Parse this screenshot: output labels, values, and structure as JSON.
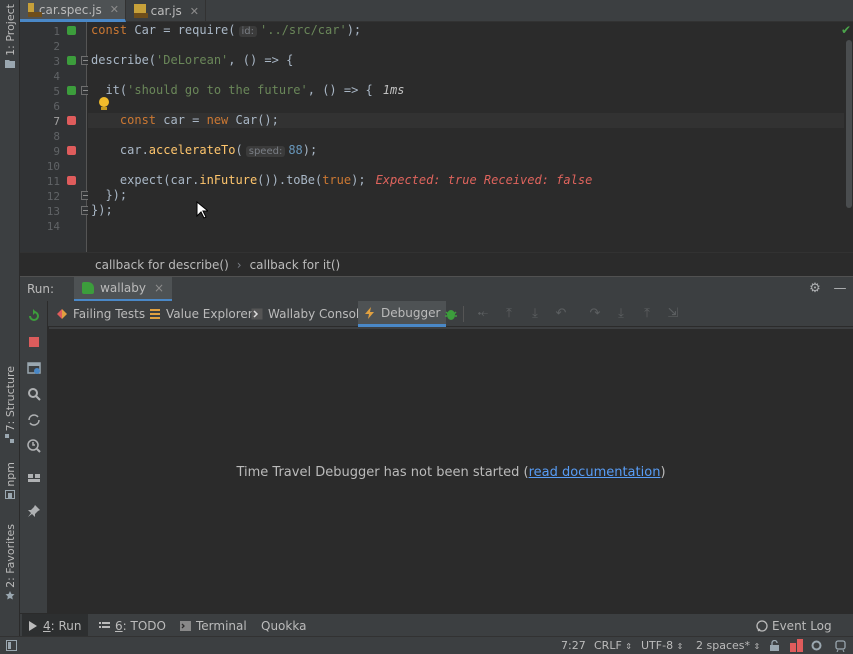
{
  "left_stripe": {
    "project": "1: Project",
    "structure": "7: Structure",
    "npm": "npm",
    "favorites": "2: Favorites"
  },
  "editor_tabs": [
    {
      "label": "car.spec.js",
      "active": true
    },
    {
      "label": "car.js",
      "active": false
    }
  ],
  "gutter": {
    "line_numbers": [
      "1",
      "2",
      "3",
      "4",
      "5",
      "6",
      "7",
      "8",
      "9",
      "10",
      "11",
      "12",
      "13",
      "14"
    ]
  },
  "code": {
    "l1": {
      "kw": "const",
      "text1": " Car = require(",
      "hint": "id:",
      "str": "'../src/car'",
      "tail": ");"
    },
    "l3": {
      "text1": "describe(",
      "str": "'DeLorean'",
      "tail": ", () => {"
    },
    "l5": {
      "text1": "  it(",
      "str": "'should go to the future'",
      "tail": ", () => {",
      "duration": "1ms"
    },
    "l7": {
      "kw1": "    const",
      "text1": " car = ",
      "kw2": "new",
      "tail": " Car();"
    },
    "l9": {
      "text1": "    car.",
      "fn": "accelerateTo",
      "p": "(",
      "hint": "speed:",
      "num": "88",
      "tail": ");"
    },
    "l11": {
      "text1": "    expect(car.",
      "fn": "inFuture",
      "text2": "()).toBe(",
      "kw": "true",
      "tail": ");",
      "error": "Expected: true Received: false"
    },
    "l12": "  });",
    "l13": "});"
  },
  "breadcrumb": {
    "first": "callback for describe()",
    "separator": "›",
    "second": "callback for it()"
  },
  "run_panel": {
    "label": "Run:",
    "tab_label": "wallaby",
    "close": "×"
  },
  "subtabs": {
    "failing_tests": "Failing Tests",
    "value_explorer": "Value Explorer",
    "wallaby_console": "Wallaby Console",
    "debugger": "Debugger"
  },
  "debugger": {
    "message": "Time Travel Debugger has not been started (",
    "link": "read documentation",
    "close_paren": ")"
  },
  "bottom_tabs": {
    "run_num": "4",
    "run_label": ": Run",
    "todo_num": "6",
    "todo_label": ": TODO",
    "terminal": "Terminal",
    "quokka": "Quokka",
    "event_log": "Event Log"
  },
  "status": {
    "position": "7:27",
    "line_ending": "CRLF",
    "encoding": "UTF-8",
    "indent": "2 spaces*"
  },
  "colors": {
    "accent": "#4a88c7",
    "pass": "#3c9d3c",
    "fail": "#df5c5c",
    "link": "#589df6"
  }
}
